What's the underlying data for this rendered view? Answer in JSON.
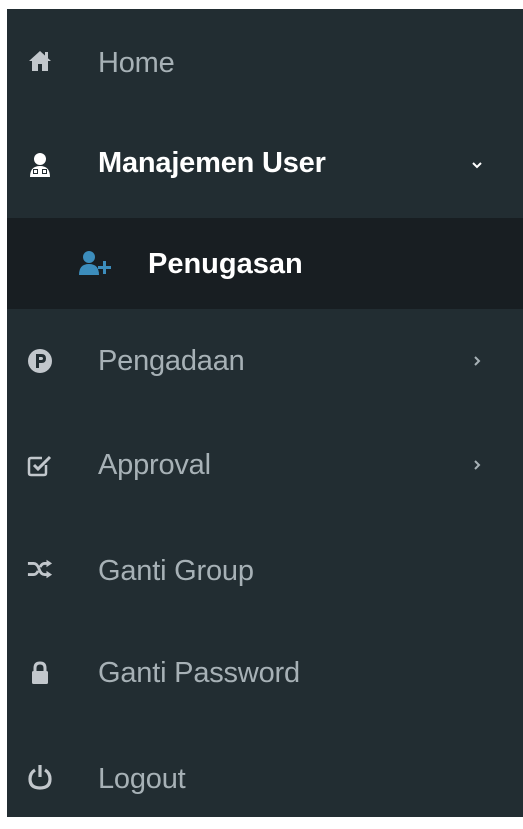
{
  "sidebar": {
    "items": [
      {
        "label": "Home",
        "icon": "home-icon"
      },
      {
        "label": "Manajemen User",
        "icon": "user-tie-icon",
        "expanded": true,
        "children": [
          {
            "label": "Penugasan",
            "icon": "user-plus-icon"
          }
        ]
      },
      {
        "label": "Pengadaan",
        "icon": "parking-circle-icon"
      },
      {
        "label": "Approval",
        "icon": "check-square-icon"
      },
      {
        "label": "Ganti Group",
        "icon": "random-icon"
      },
      {
        "label": "Ganti Password",
        "icon": "lock-icon"
      },
      {
        "label": "Logout",
        "icon": "power-off-icon"
      }
    ]
  },
  "colors": {
    "sidebar_bg": "#222d32",
    "submenu_bg": "#181e22",
    "text_muted": "#a7b1b6",
    "text_active": "#ffffff",
    "accent_blue": "#3c8dbc"
  }
}
